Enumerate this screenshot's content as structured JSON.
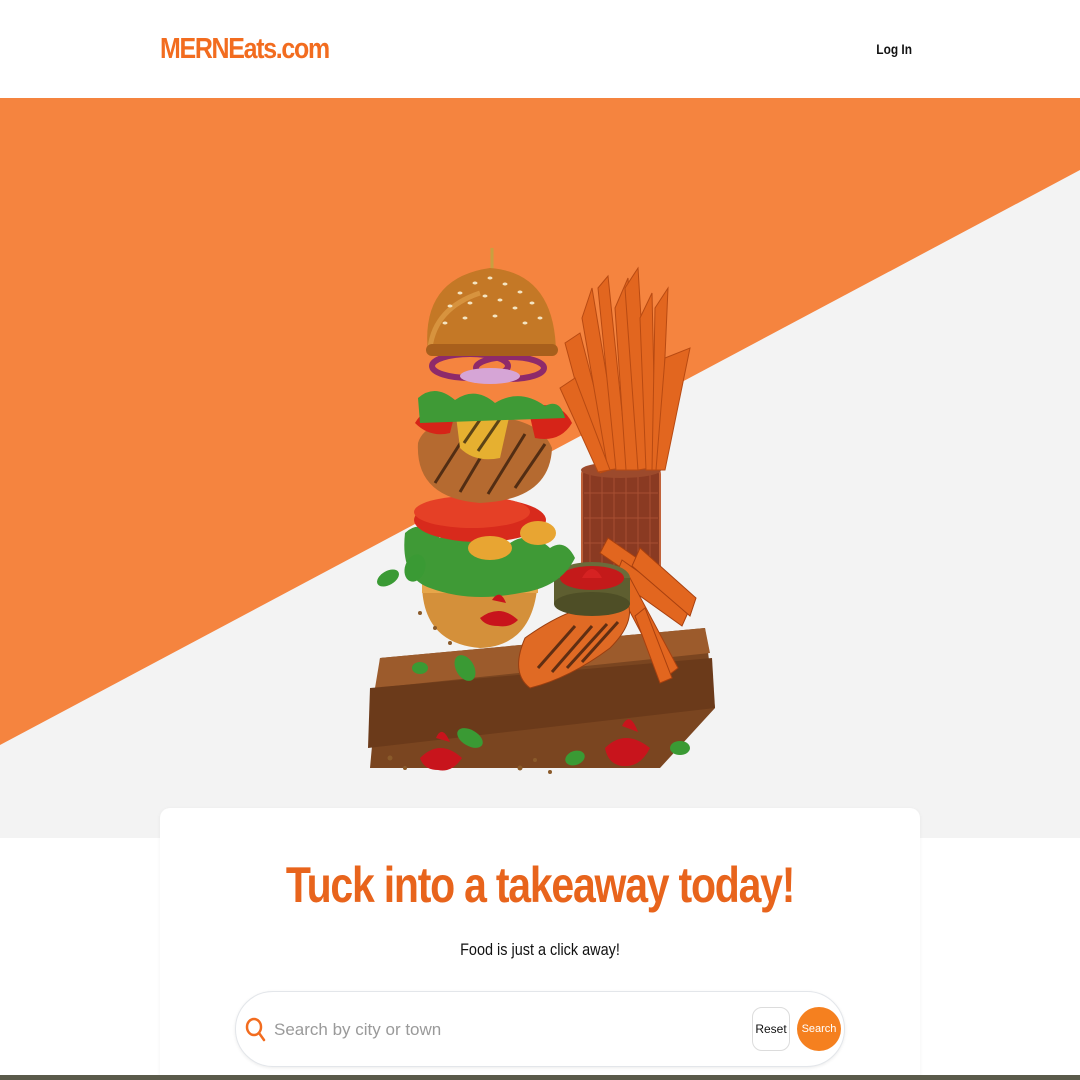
{
  "header": {
    "logo": "MERNEats.com",
    "login_label": "Log In"
  },
  "colors": {
    "brand": "#f26c1f",
    "hero_orange": "#f5843f",
    "hero_grey": "#f3f3f3",
    "search_button": "#f5801f"
  },
  "hero": {
    "image_icon": "burger-and-fries-illustration"
  },
  "search_card": {
    "headline": "Tuck into a takeaway today!",
    "subheadline": "Food is just a click away!",
    "search_placeholder": "Search by city or town",
    "search_value": "",
    "reset_label": "Reset",
    "search_label": "Search",
    "search_icon": "search-icon"
  }
}
